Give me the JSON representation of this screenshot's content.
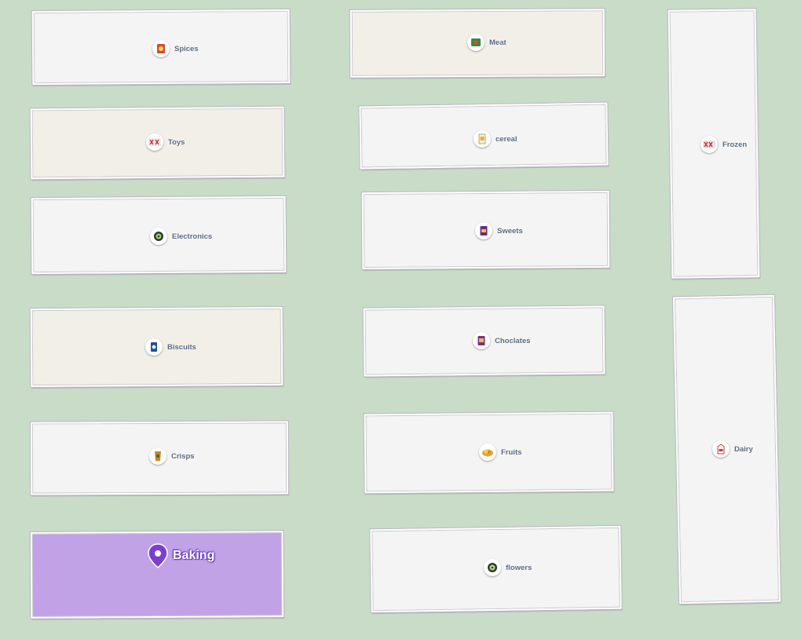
{
  "map": {
    "aisles": [
      {
        "label": "Spices",
        "icon": "spice-pack-icon",
        "fill": "#f4f4f4"
      },
      {
        "label": "Meat",
        "icon": "meat-pack-icon",
        "fill": "#f2efe8"
      },
      {
        "label": "Frozen",
        "icon": "frozen-pack-icon",
        "fill": "#f4f4f4"
      },
      {
        "label": "Toys",
        "icon": "toy-box-icon",
        "fill": "#f2efe8"
      },
      {
        "label": "cereal",
        "icon": "cereal-box-icon",
        "fill": "#f4f4f4"
      },
      {
        "label": "Electronics",
        "icon": "electronics-icon",
        "fill": "#f4f4f4"
      },
      {
        "label": "Sweets",
        "icon": "sweets-pack-icon",
        "fill": "#f4f4f4"
      },
      {
        "label": "Biscuits",
        "icon": "biscuit-pack-icon",
        "fill": "#f2efe8"
      },
      {
        "label": "Choclates",
        "icon": "chocolate-box-icon",
        "fill": "#f4f4f4"
      },
      {
        "label": "Dairy",
        "icon": "dairy-carton-icon",
        "fill": "#f4f4f4"
      },
      {
        "label": "Crisps",
        "icon": "crisps-bag-icon",
        "fill": "#f4f4f4"
      },
      {
        "label": "Fruits",
        "icon": "fruit-basket-icon",
        "fill": "#f4f4f4"
      },
      {
        "label": "Baking",
        "icon": "location-pin-icon",
        "fill": "#c2a2e6",
        "selected": true
      },
      {
        "label": "flowers",
        "icon": "flower-pack-icon",
        "fill": "#f4f4f4"
      }
    ],
    "colors": {
      "background": "#c8dcc8",
      "aisle": "#f4f4f4",
      "aisle_alt": "#f2efe8",
      "selected": "#c2a2e6",
      "pin": "#7b3fd0",
      "label": "#5b6a7e"
    }
  }
}
